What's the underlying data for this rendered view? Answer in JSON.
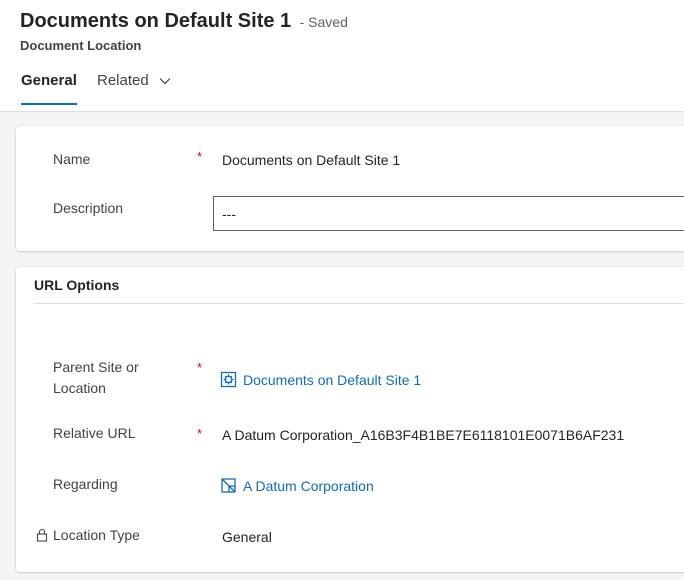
{
  "header": {
    "title": "Documents on Default Site 1",
    "save_status": "- Saved",
    "entity_name": "Document Location"
  },
  "tabs": [
    {
      "label": "General",
      "selected": true
    },
    {
      "label": "Related",
      "selected": false
    }
  ],
  "general_section": {
    "name_label": "Name",
    "name_value": "Documents on Default Site 1",
    "description_label": "Description",
    "description_value": "---"
  },
  "url_section": {
    "title": "URL Options",
    "parent_label": "Parent Site or Location",
    "parent_value": "Documents on Default Site 1",
    "relative_url_label": "Relative URL",
    "relative_url_value": "A Datum Corporation_A16B3F4B1BE7E6118101E0071B6AF231",
    "regarding_label": "Regarding",
    "regarding_value": "A Datum Corporation",
    "location_type_label": "Location Type",
    "location_type_value": "General"
  },
  "colors": {
    "accent": "#0f6cbd",
    "required": "#c50f1f",
    "background": "#f5f5f5"
  },
  "icons": {
    "parent_lookup": "sharepoint-site-icon",
    "regarding_lookup": "account-record-icon",
    "locked_field": "lock-icon",
    "tab_dropdown": "chevron-down-icon"
  }
}
